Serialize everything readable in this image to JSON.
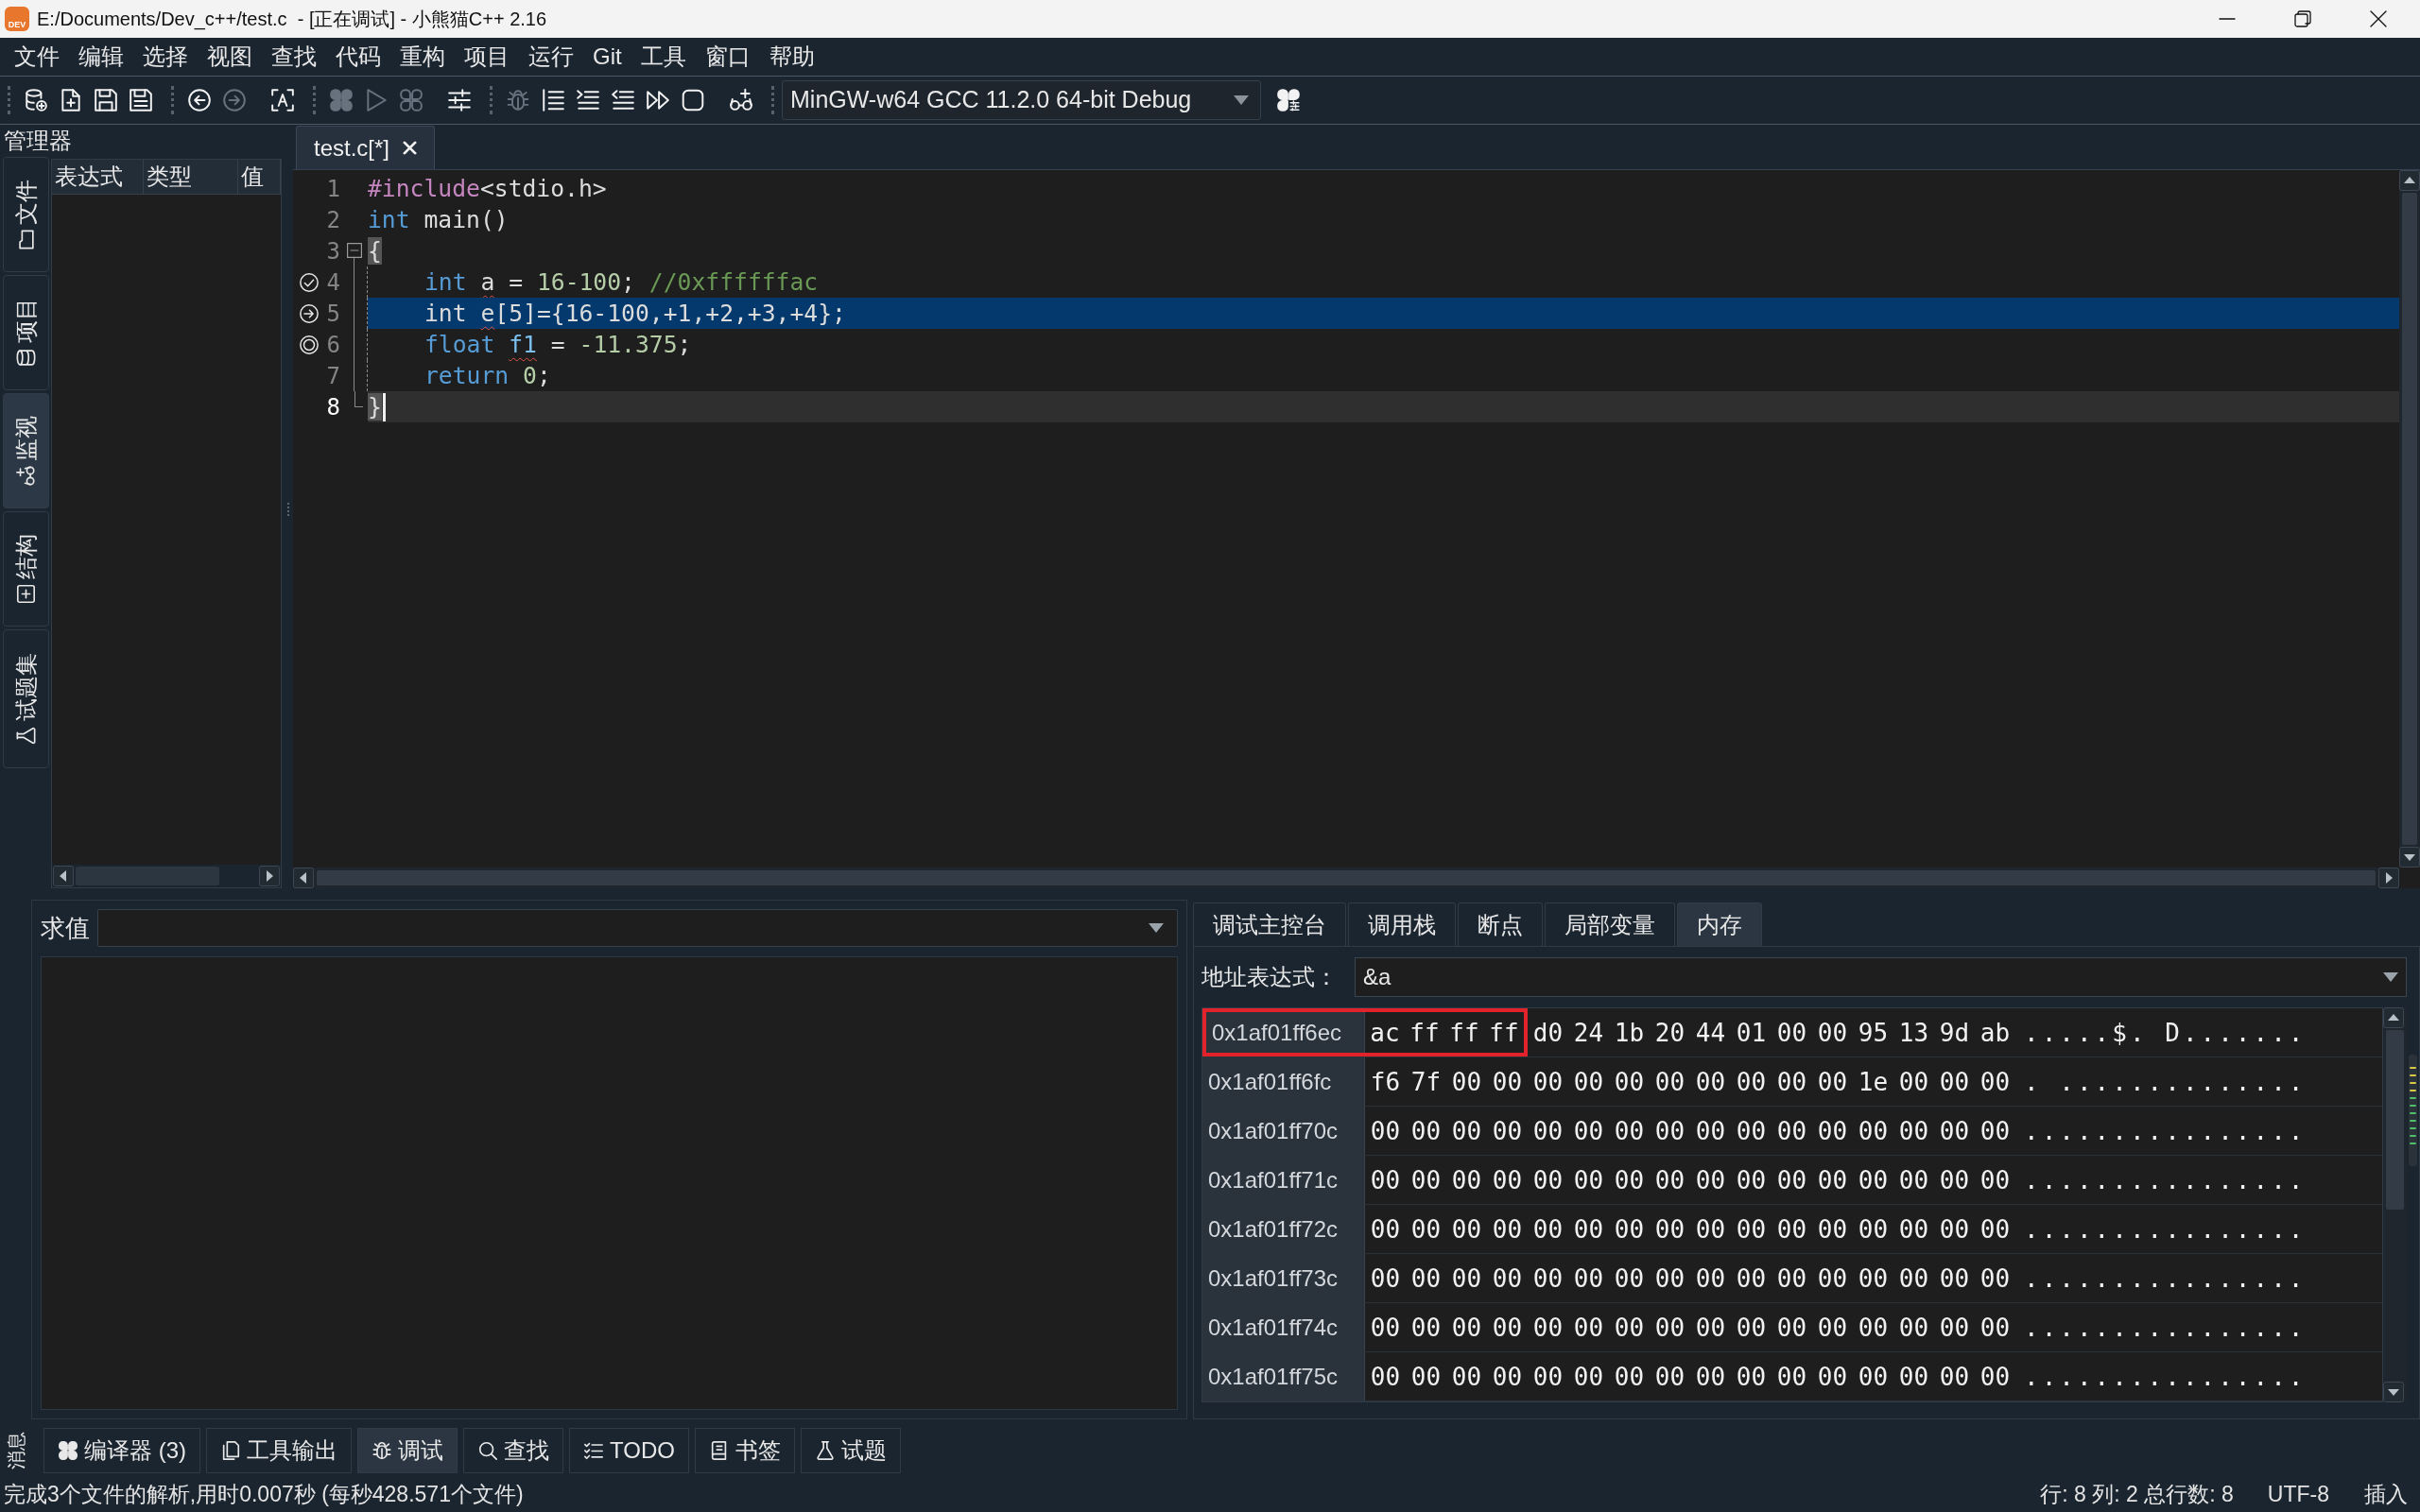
{
  "window": {
    "logo_text": "DEV",
    "title": "E:/Documents/Dev_c++/test.c  - [正在调试] - 小熊猫C++ 2.16"
  },
  "menu": [
    "文件",
    "编辑",
    "选择",
    "视图",
    "查找",
    "代码",
    "重构",
    "项目",
    "运行",
    "Git",
    "工具",
    "窗口",
    "帮助"
  ],
  "toolbar": [
    {
      "grip": true,
      "items": [
        {
          "kind": "project",
          "disabled": false
        },
        {
          "kind": "newfile",
          "disabled": false
        },
        {
          "kind": "save",
          "disabled": false
        },
        {
          "kind": "saveall",
          "disabled": false
        }
      ]
    },
    {
      "grip": true,
      "items": [
        {
          "kind": "back",
          "disabled": false
        },
        {
          "kind": "forward",
          "disabled": true
        }
      ]
    },
    {
      "grip": false,
      "items": [
        {
          "kind": "format",
          "disabled": false
        }
      ]
    },
    {
      "grip": true,
      "items": [
        {
          "kind": "compile",
          "disabled": true
        },
        {
          "kind": "run",
          "disabled": true
        },
        {
          "kind": "compilerun",
          "disabled": true
        }
      ]
    },
    {
      "grip": false,
      "items": [
        {
          "kind": "options",
          "disabled": false
        }
      ]
    },
    {
      "grip": true,
      "items": [
        {
          "kind": "debug",
          "disabled": true
        },
        {
          "kind": "stepover",
          "disabled": false
        },
        {
          "kind": "stepinto",
          "disabled": false
        },
        {
          "kind": "stepout",
          "disabled": false
        },
        {
          "kind": "continue",
          "disabled": false
        },
        {
          "kind": "stop",
          "disabled": false
        }
      ]
    },
    {
      "grip": false,
      "items": [
        {
          "kind": "watch",
          "disabled": false
        }
      ]
    },
    {
      "grip": true,
      "items": [
        {
          "kind": "select",
          "value": "MinGW-w64 GCC 11.2.0 64-bit Debug"
        },
        {
          "kind": "compilerset",
          "disabled": false
        }
      ]
    }
  ],
  "manager": {
    "title": "管理器",
    "tabs": [
      {
        "label": "文件",
        "selected": false
      },
      {
        "label": "项目",
        "selected": false
      },
      {
        "label": "监视",
        "selected": true
      },
      {
        "label": "结构",
        "selected": false
      },
      {
        "label": "试题集",
        "selected": false
      }
    ]
  },
  "watch": {
    "columns": [
      "表达式",
      "类型",
      "值"
    ]
  },
  "editor": {
    "tab": {
      "label": "test.c[*]",
      "selected": true
    },
    "lines": [
      {
        "number": "1",
        "highlighted": false,
        "current": false,
        "tokens": [
          {
            "text": "#include",
            "kind": "preproc",
            "warning": false
          },
          {
            "text": "<stdio.h>",
            "kind": "plain",
            "warning": false
          }
        ]
      },
      {
        "number": "2",
        "highlighted": false,
        "current": false,
        "tokens": [
          {
            "text": "int",
            "kind": "keyword",
            "warning": false
          },
          {
            "text": " main()",
            "kind": "plain",
            "warning": false
          }
        ]
      },
      {
        "number": "3",
        "highlighted": false,
        "current": false,
        "expanded": true,
        "tokens": [
          {
            "text": "{",
            "kind": "brace",
            "warning": false
          }
        ],
        "children": [
          {
            "number": "4",
            "marker": {
              "kind": "check"
            },
            "highlighted": false,
            "current": false,
            "tokens": [
              {
                "text": "int ",
                "kind": "keyword",
                "warning": false
              },
              {
                "text": "a",
                "kind": "plain",
                "warning": true
              },
              {
                "text": " = ",
                "kind": "plain",
                "warning": false
              },
              {
                "text": "16-100",
                "kind": "number",
                "warning": false
              },
              {
                "text": "; ",
                "kind": "plain",
                "warning": false
              },
              {
                "text": "//0xffffffac",
                "kind": "comment",
                "warning": false
              }
            ]
          },
          {
            "number": "5",
            "marker": {
              "kind": "arrow"
            },
            "highlighted": true,
            "current": false,
            "tokens": [
              {
                "text": "int ",
                "kind": "plain",
                "warning": false
              },
              {
                "text": "e",
                "kind": "plain",
                "warning": true
              },
              {
                "text": "[5]={16-100,+1,+2,+3,+4};",
                "kind": "plain",
                "warning": false
              }
            ]
          },
          {
            "number": "6",
            "marker": {
              "kind": "breakpoint"
            },
            "highlighted": false,
            "current": false,
            "tokens": [
              {
                "text": "float ",
                "kind": "keyword",
                "warning": false
              },
              {
                "text": "f1",
                "kind": "ident",
                "warning": true
              },
              {
                "text": " = ",
                "kind": "plain",
                "warning": false
              },
              {
                "text": "-11.375",
                "kind": "number",
                "warning": false
              },
              {
                "text": ";",
                "kind": "plain",
                "warning": false
              }
            ]
          },
          {
            "number": "7",
            "highlighted": false,
            "current": false,
            "tokens": [
              {
                "text": "return ",
                "kind": "keyword",
                "warning": false
              },
              {
                "text": "0",
                "kind": "number",
                "warning": false
              },
              {
                "text": ";",
                "kind": "plain",
                "warning": false
              }
            ]
          }
        ]
      },
      {
        "number": "8",
        "highlighted": false,
        "current": true,
        "tokens": [
          {
            "text": "}",
            "kind": "brace",
            "warning": false
          }
        ]
      }
    ]
  },
  "evaluate": {
    "label": "求值"
  },
  "debug": {
    "tabs": [
      {
        "label": "调试主控台",
        "selected": false
      },
      {
        "label": "调用栈",
        "selected": false
      },
      {
        "label": "断点",
        "selected": false
      },
      {
        "label": "局部变量",
        "selected": false
      },
      {
        "label": "内存",
        "selected": true
      }
    ],
    "address_label": "地址表达式：",
    "address_value": "&a",
    "memory": [
      {
        "address": "0x1af01ff6ec",
        "marked": true,
        "marked_bytes": [
          "ac",
          "ff",
          "ff",
          "ff"
        ],
        "bytes": [
          "d0",
          "24",
          "1b",
          "20",
          "44",
          "01",
          "00",
          "00",
          "95",
          "13",
          "9d",
          "ab"
        ],
        "ascii": ".....$. D......."
      },
      {
        "address": "0x1af01ff6fc",
        "marked": false,
        "bytes": [
          "f6",
          "7f",
          "00",
          "00",
          "00",
          "00",
          "00",
          "00",
          "00",
          "00",
          "00",
          "00",
          "1e",
          "00",
          "00",
          "00"
        ],
        "ascii": ". .............."
      },
      {
        "address": "0x1af01ff70c",
        "marked": false,
        "bytes": [
          "00",
          "00",
          "00",
          "00",
          "00",
          "00",
          "00",
          "00",
          "00",
          "00",
          "00",
          "00",
          "00",
          "00",
          "00",
          "00"
        ],
        "ascii": "................"
      },
      {
        "address": "0x1af01ff71c",
        "marked": false,
        "bytes": [
          "00",
          "00",
          "00",
          "00",
          "00",
          "00",
          "00",
          "00",
          "00",
          "00",
          "00",
          "00",
          "00",
          "00",
          "00",
          "00"
        ],
        "ascii": "................"
      },
      {
        "address": "0x1af01ff72c",
        "marked": false,
        "bytes": [
          "00",
          "00",
          "00",
          "00",
          "00",
          "00",
          "00",
          "00",
          "00",
          "00",
          "00",
          "00",
          "00",
          "00",
          "00",
          "00"
        ],
        "ascii": "................"
      },
      {
        "address": "0x1af01ff73c",
        "marked": false,
        "bytes": [
          "00",
          "00",
          "00",
          "00",
          "00",
          "00",
          "00",
          "00",
          "00",
          "00",
          "00",
          "00",
          "00",
          "00",
          "00",
          "00"
        ],
        "ascii": "................"
      },
      {
        "address": "0x1af01ff74c",
        "marked": false,
        "bytes": [
          "00",
          "00",
          "00",
          "00",
          "00",
          "00",
          "00",
          "00",
          "00",
          "00",
          "00",
          "00",
          "00",
          "00",
          "00",
          "00"
        ],
        "ascii": "................"
      },
      {
        "address": "0x1af01ff75c",
        "marked": false,
        "bytes": [
          "00",
          "00",
          "00",
          "00",
          "00",
          "00",
          "00",
          "00",
          "00",
          "00",
          "00",
          "00",
          "00",
          "00",
          "00",
          "00"
        ],
        "ascii": "................"
      }
    ]
  },
  "bottom_tabs": {
    "side_label": "消息",
    "tabs": [
      {
        "label": "编译器 (3)",
        "selected": false
      },
      {
        "label": "工具输出",
        "selected": false
      },
      {
        "label": "调试",
        "selected": true
      },
      {
        "label": "查找",
        "selected": false
      },
      {
        "label": "TODO",
        "selected": false
      },
      {
        "label": "书签",
        "selected": false
      },
      {
        "label": "试题",
        "selected": false
      }
    ]
  },
  "status_bar": {
    "message": "完成3个文件的解析,用时0.007秒 (每秒428.571个文件)",
    "position": "行: 8 列: 2 总行数: 8",
    "encoding": "UTF-8",
    "mode": "插入"
  }
}
